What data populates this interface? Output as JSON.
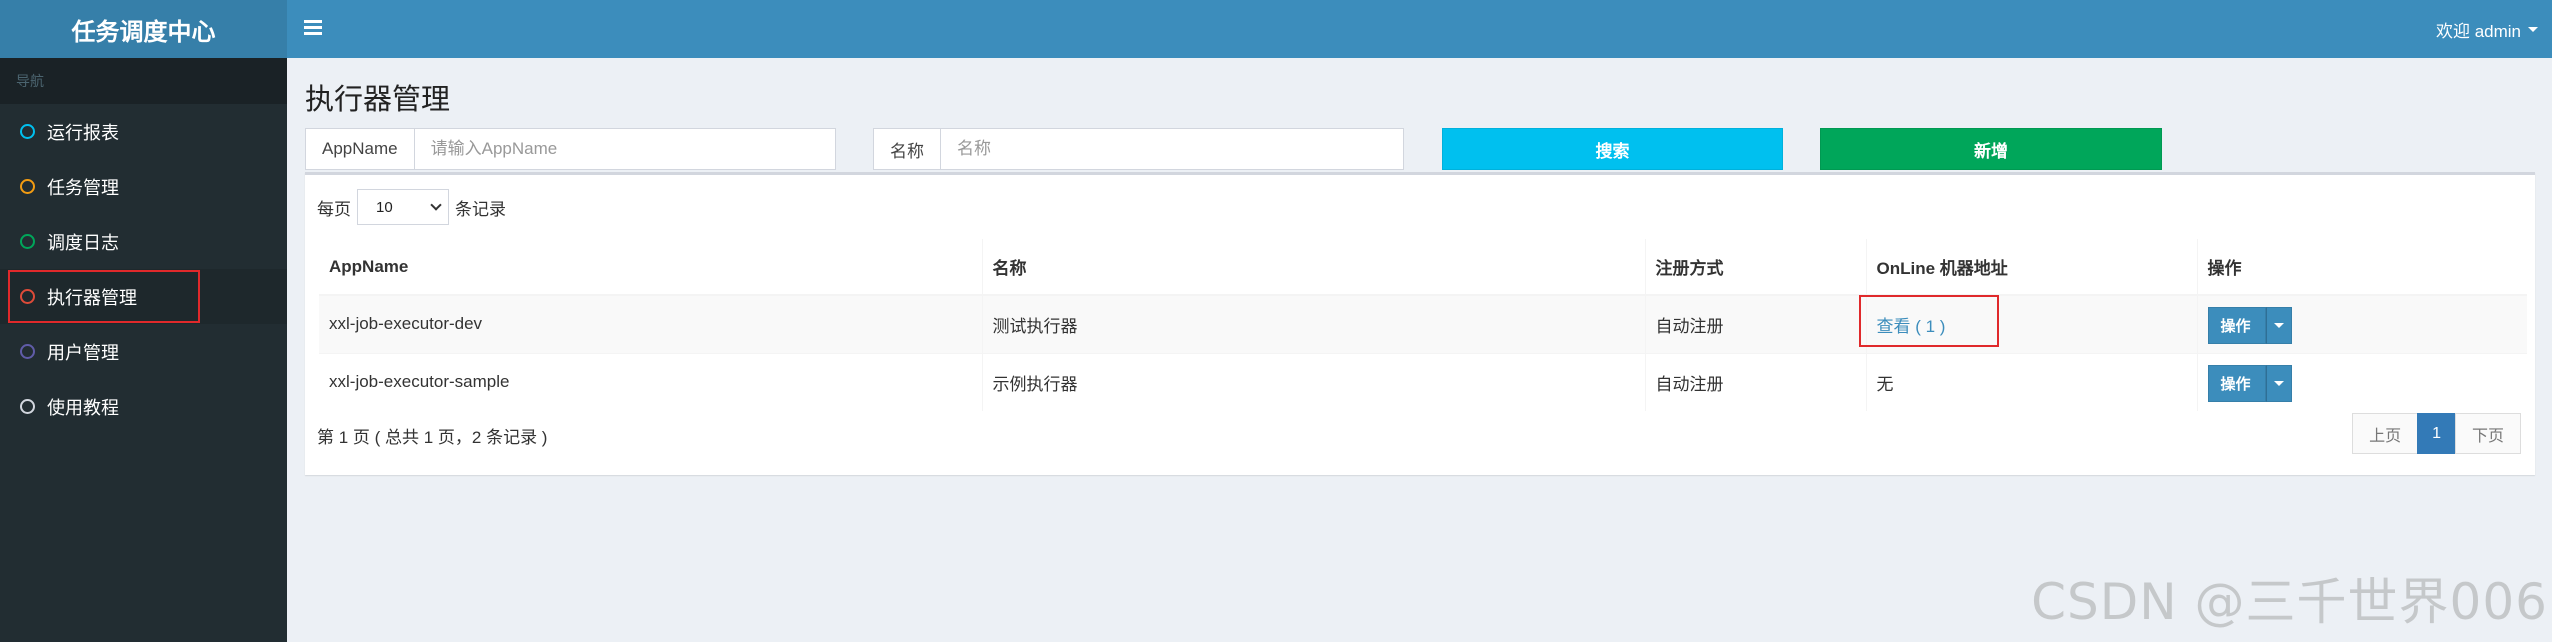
{
  "app": {
    "title": "任务调度中心"
  },
  "header": {
    "welcome": "欢迎 admin"
  },
  "sidebar": {
    "header": "导航",
    "items": [
      {
        "label": "运行报表",
        "color": "#00c0ef"
      },
      {
        "label": "任务管理",
        "color": "#f39c12"
      },
      {
        "label": "调度日志",
        "color": "#00a65a"
      },
      {
        "label": "执行器管理",
        "color": "#dd4b39",
        "active": true
      },
      {
        "label": "用户管理",
        "color": "#605ca8"
      },
      {
        "label": "使用教程",
        "color": "#d2d6de"
      }
    ]
  },
  "page": {
    "title": "执行器管理"
  },
  "filters": {
    "appname_label": "AppName",
    "appname_placeholder": "请输入AppName",
    "name_label": "名称",
    "name_placeholder": "名称",
    "search_label": "搜索",
    "add_label": "新增"
  },
  "table": {
    "length_prefix": "每页",
    "length_value": "10",
    "length_suffix": "条记录",
    "columns": [
      "AppName",
      "名称",
      "注册方式",
      "OnLine 机器地址",
      "操作"
    ],
    "rows": [
      {
        "appname": "xxl-job-executor-dev",
        "name": "测试执行器",
        "reg": "自动注册",
        "online": "查看 ( 1 )",
        "op": "操作"
      },
      {
        "appname": "xxl-job-executor-sample",
        "name": "示例执行器",
        "reg": "自动注册",
        "online": "无",
        "op": "操作"
      }
    ],
    "info": "第 1 页 ( 总共 1 页，2 条记录 )",
    "pager": {
      "prev": "上页",
      "current": "1",
      "next": "下页"
    }
  },
  "watermark": "CSDN @三千世界006",
  "colors": {
    "topbar": "#3c8dbc",
    "sidebar": "#222d32",
    "search": "#00c0ef",
    "add": "#00a65a",
    "highlight": "#e0292b"
  }
}
